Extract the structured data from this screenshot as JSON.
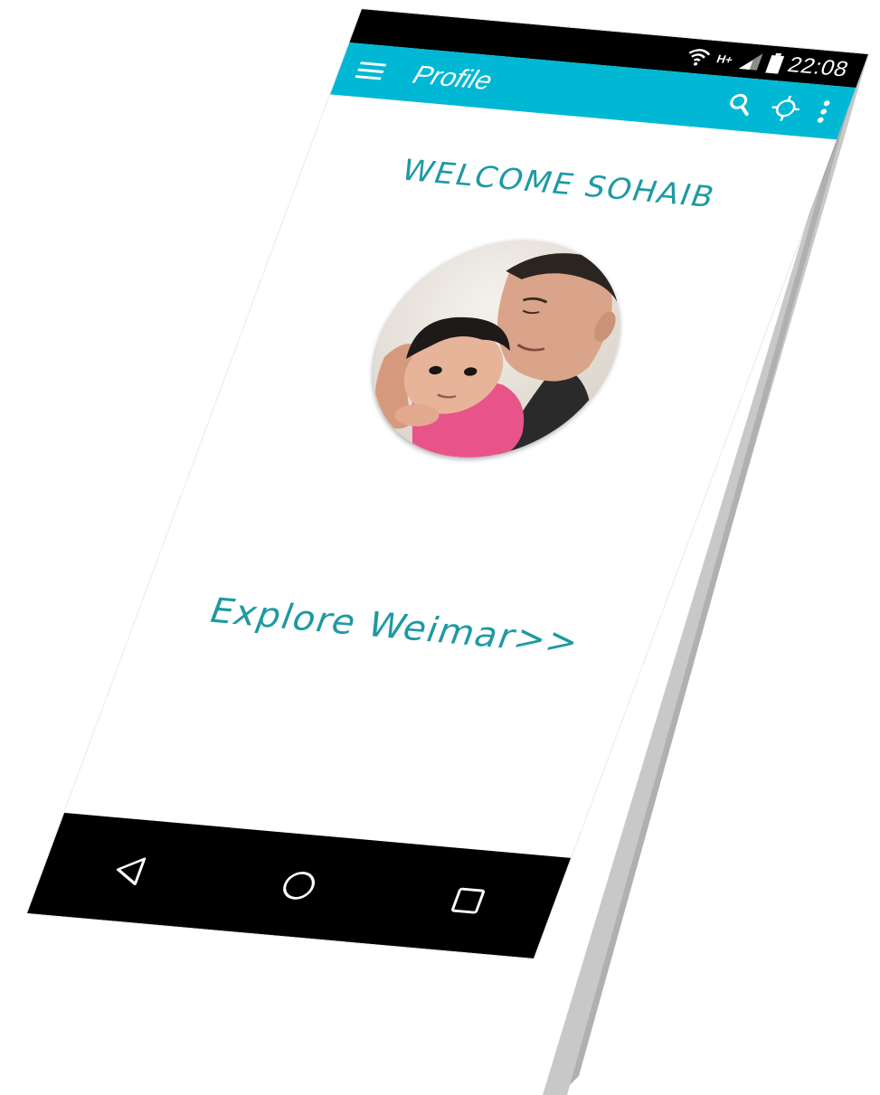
{
  "status_bar": {
    "network_type": "H+",
    "time": "22:08"
  },
  "app_bar": {
    "title": "Profile",
    "menu_icon": "hamburger-menu-icon",
    "actions": [
      "search-icon",
      "location-target-icon",
      "overflow-menu-icon"
    ]
  },
  "profile": {
    "welcome_text": "WELCOME SOHAIB",
    "avatar_image": "profile-photo"
  },
  "links": {
    "explore_label": "Explore Weimar>>"
  },
  "nav_bar": {
    "buttons": [
      "back-icon",
      "home-icon",
      "recents-icon"
    ]
  },
  "colors": {
    "app_bar": "#00b8d4",
    "accent_text": "#1e9aa3",
    "status_bar": "#000000",
    "nav_bar": "#000000",
    "screen_background": "#ffffff"
  }
}
